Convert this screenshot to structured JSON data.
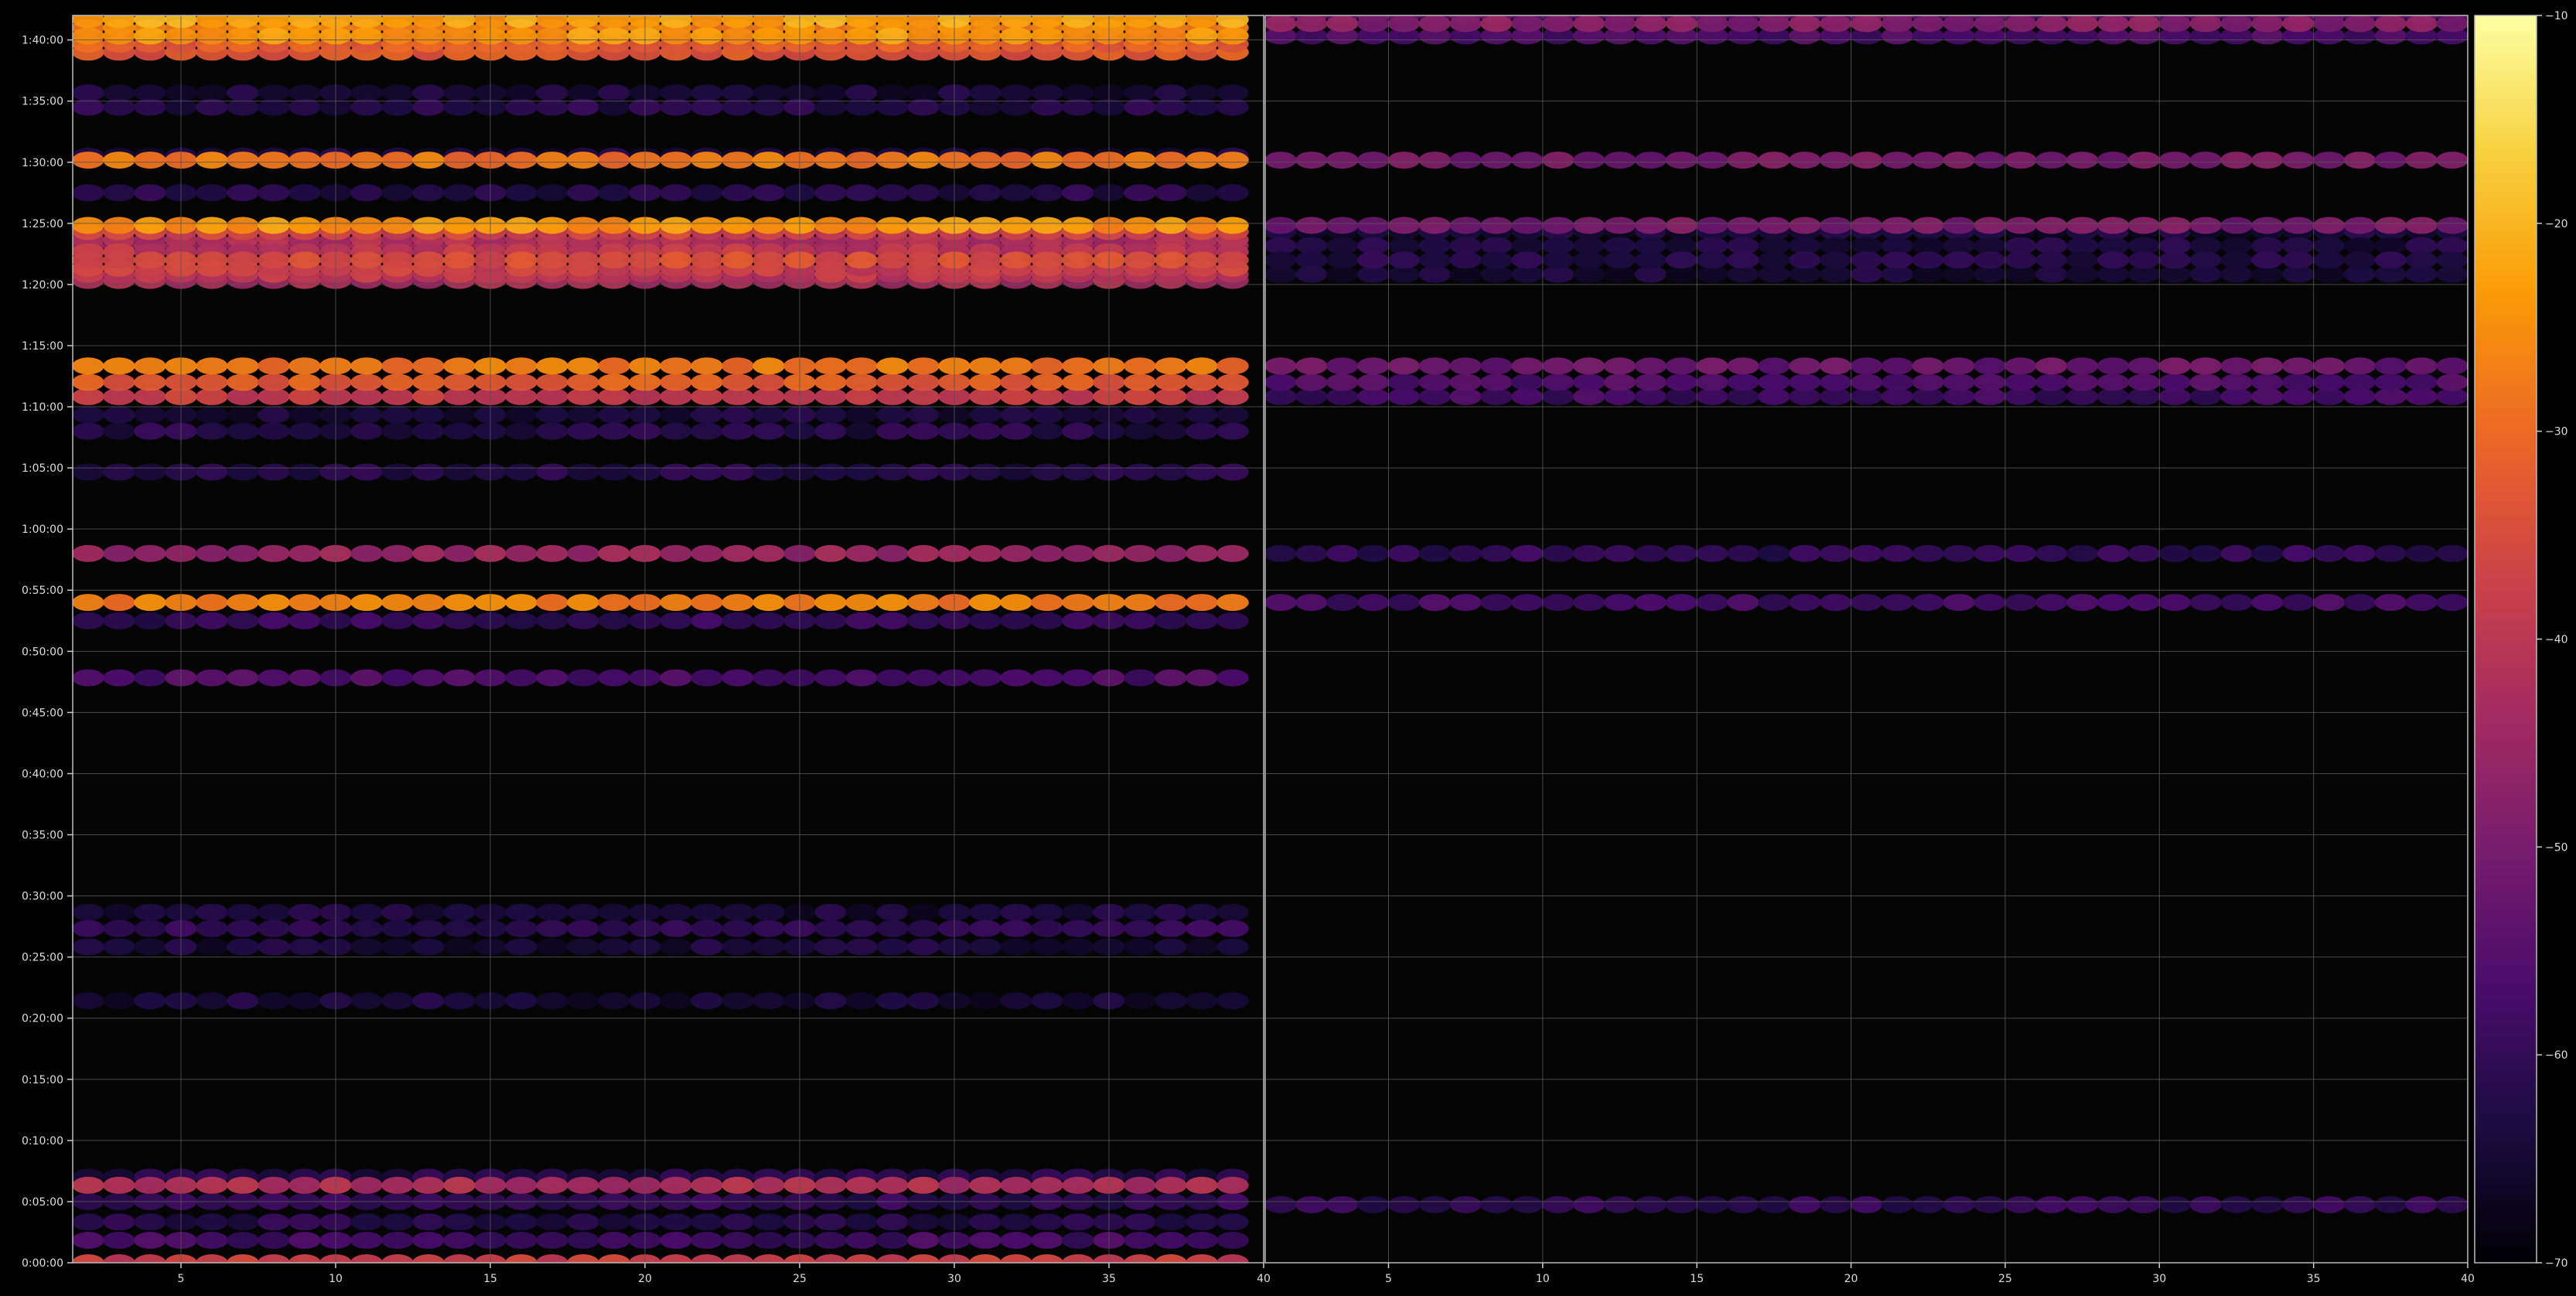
{
  "chart_data": {
    "type": "heatmap",
    "title": "",
    "xlabel": "",
    "ylabel": "",
    "background": "#000000",
    "grid": true,
    "grid_color": "#555555",
    "colormap": "inferno",
    "colormap_stops": [
      "#000004",
      "#1b0c41",
      "#4a0c6b",
      "#781c6d",
      "#a52c60",
      "#cf4446",
      "#ed6925",
      "#fb9b06",
      "#f7d13d",
      "#fcffa4"
    ],
    "colorbar": {
      "min": -70,
      "max": -10,
      "ticks": [
        -70,
        -60,
        -50,
        -40,
        -30,
        -20,
        -10
      ],
      "tick_labels": [
        "−70",
        "−60",
        "−50",
        "−40",
        "−30",
        "−20",
        "−10"
      ]
    },
    "y_axis": {
      "unit": "h:mm:ss",
      "min_seconds": 0,
      "max_seconds": 6120,
      "tick_seconds": [
        0,
        300,
        600,
        900,
        1200,
        1500,
        1800,
        2100,
        2400,
        2700,
        3000,
        3300,
        3600,
        3900,
        4200,
        4500,
        4800,
        5100,
        5400,
        5700,
        6000
      ],
      "tick_labels": [
        "0:00:00",
        "0:05:00",
        "0:10:00",
        "0:15:00",
        "0:20:00",
        "0:25:00",
        "0:30:00",
        "0:35:00",
        "0:40:00",
        "0:45:00",
        "0:50:00",
        "0:55:00",
        "1:00:00",
        "1:05:00",
        "1:10:00",
        "1:15:00",
        "1:20:00",
        "1:25:00",
        "1:30:00",
        "1:35:00",
        "1:40:00"
      ]
    },
    "panels": [
      {
        "name": "left",
        "x_range": [
          1.5,
          40
        ],
        "x_ticks": [
          5,
          10,
          15,
          20,
          25,
          30,
          35,
          40
        ],
        "x_tick_labels": [
          "5",
          "10",
          "15",
          "20",
          "25",
          "30",
          "35",
          "40"
        ],
        "x_start": 2,
        "x_end": 39,
        "bands": [
          {
            "t": 0,
            "v": -38
          },
          {
            "t": 110,
            "v": -58
          },
          {
            "t": 200,
            "v": -62
          },
          {
            "t": 300,
            "v": -60
          },
          {
            "t": 380,
            "v": -42
          },
          {
            "t": 420,
            "v": -62
          },
          {
            "t": 1285,
            "v": -64
          },
          {
            "t": 1550,
            "v": -64
          },
          {
            "t": 1640,
            "v": -60
          },
          {
            "t": 1720,
            "v": -64
          },
          {
            "t": 2870,
            "v": -56
          },
          {
            "t": 3150,
            "v": -60
          },
          {
            "t": 3240,
            "v": -27
          },
          {
            "t": 3480,
            "v": -45
          },
          {
            "t": 3880,
            "v": -62
          },
          {
            "t": 4080,
            "v": -62
          },
          {
            "t": 4160,
            "v": -64
          },
          {
            "t": 4250,
            "v": -38
          },
          {
            "t": 4320,
            "v": -32
          },
          {
            "t": 4400,
            "v": -28
          },
          {
            "t": 4820,
            "v": -43
          },
          {
            "t": 4850,
            "v": -40
          },
          {
            "t": 4880,
            "v": -38
          },
          {
            "t": 4920,
            "v": -35
          },
          {
            "t": 4960,
            "v": -40
          },
          {
            "t": 4990,
            "v": -44
          },
          {
            "t": 5020,
            "v": -42
          },
          {
            "t": 5060,
            "v": -37
          },
          {
            "t": 5090,
            "v": -24
          },
          {
            "t": 5250,
            "v": -62
          },
          {
            "t": 5410,
            "v": -28
          },
          {
            "t": 5430,
            "v": -64
          },
          {
            "t": 5670,
            "v": -62
          },
          {
            "t": 5740,
            "v": -64
          },
          {
            "t": 5940,
            "v": -33
          },
          {
            "t": 5980,
            "v": -32
          },
          {
            "t": 6020,
            "v": -24
          },
          {
            "t": 6060,
            "v": -26
          },
          {
            "t": 6100,
            "v": -22
          }
        ]
      },
      {
        "name": "right",
        "x_range": [
          1,
          40
        ],
        "x_ticks": [
          5,
          10,
          15,
          20,
          25,
          30,
          35,
          40
        ],
        "x_tick_labels": [
          "5",
          "10",
          "15",
          "20",
          "25",
          "30",
          "35",
          "40"
        ],
        "x_start": 1.5,
        "x_end": 39.5,
        "bands": [
          {
            "t": 285,
            "v": -60
          },
          {
            "t": 3240,
            "v": -58
          },
          {
            "t": 3480,
            "v": -60
          },
          {
            "t": 4400,
            "v": -52
          },
          {
            "t": 4320,
            "v": -56
          },
          {
            "t": 4250,
            "v": -58
          },
          {
            "t": 4850,
            "v": -64
          },
          {
            "t": 4920,
            "v": -62
          },
          {
            "t": 4990,
            "v": -63
          },
          {
            "t": 5060,
            "v": -64
          },
          {
            "t": 5090,
            "v": -50
          },
          {
            "t": 5410,
            "v": -50
          },
          {
            "t": 6020,
            "v": -56
          },
          {
            "t": 6080,
            "v": -48
          },
          {
            "t": 6120,
            "v": -52
          }
        ]
      }
    ]
  }
}
